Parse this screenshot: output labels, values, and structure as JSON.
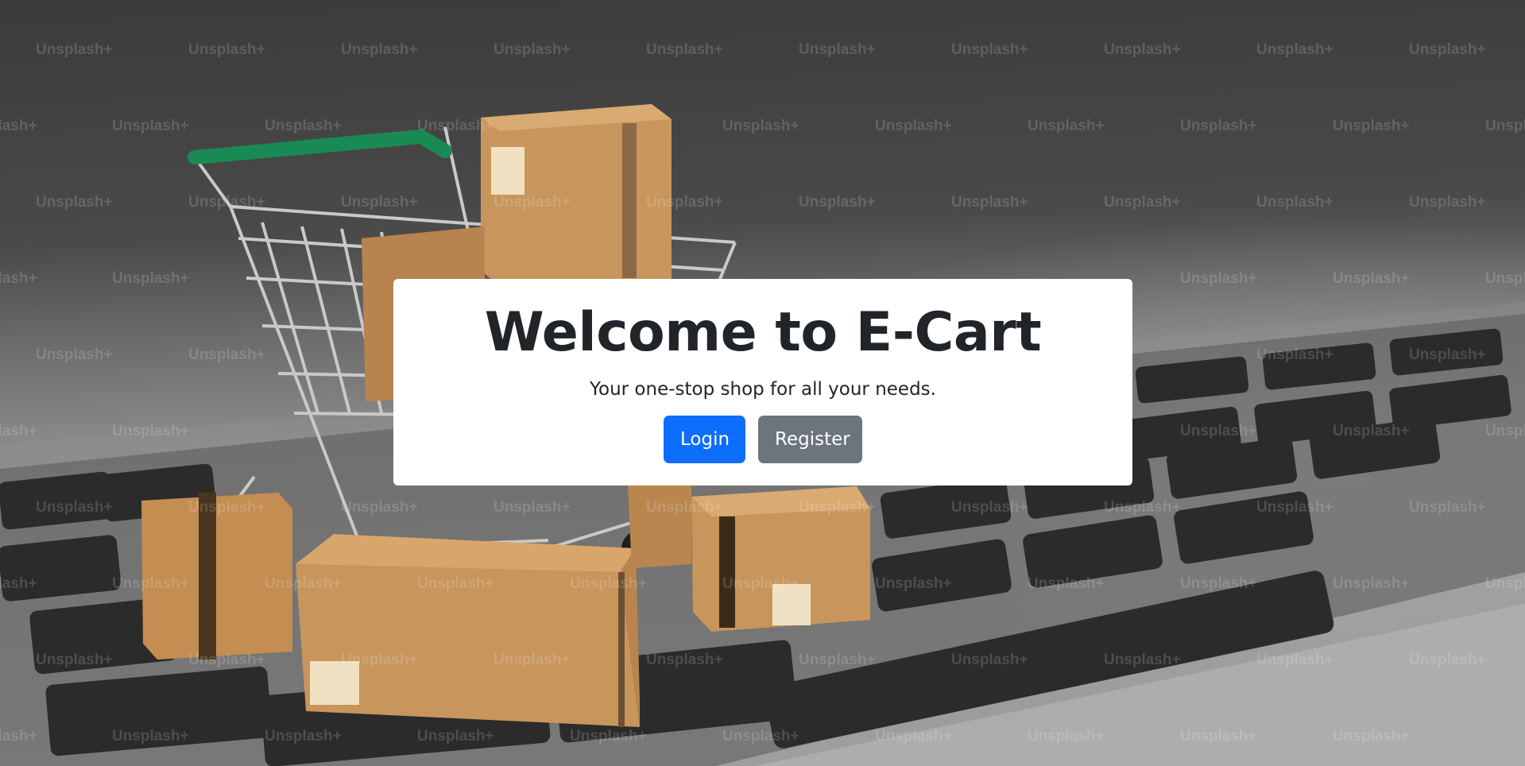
{
  "hero": {
    "title": "Welcome to E-Cart",
    "subtitle": "Your one-stop shop for all your needs.",
    "login_label": "Login",
    "register_label": "Register"
  },
  "watermark_text": "Unsplash+",
  "colors": {
    "login_button": "#0d6efd",
    "register_button": "#6c757d",
    "title_text": "#212529",
    "card_background": "#ffffff",
    "cart_handle": "#1a8a55",
    "box": "#c8955c"
  },
  "icons": [
    "shopping-cart-illustration",
    "cardboard-box-illustration",
    "laptop-keyboard-illustration"
  ]
}
